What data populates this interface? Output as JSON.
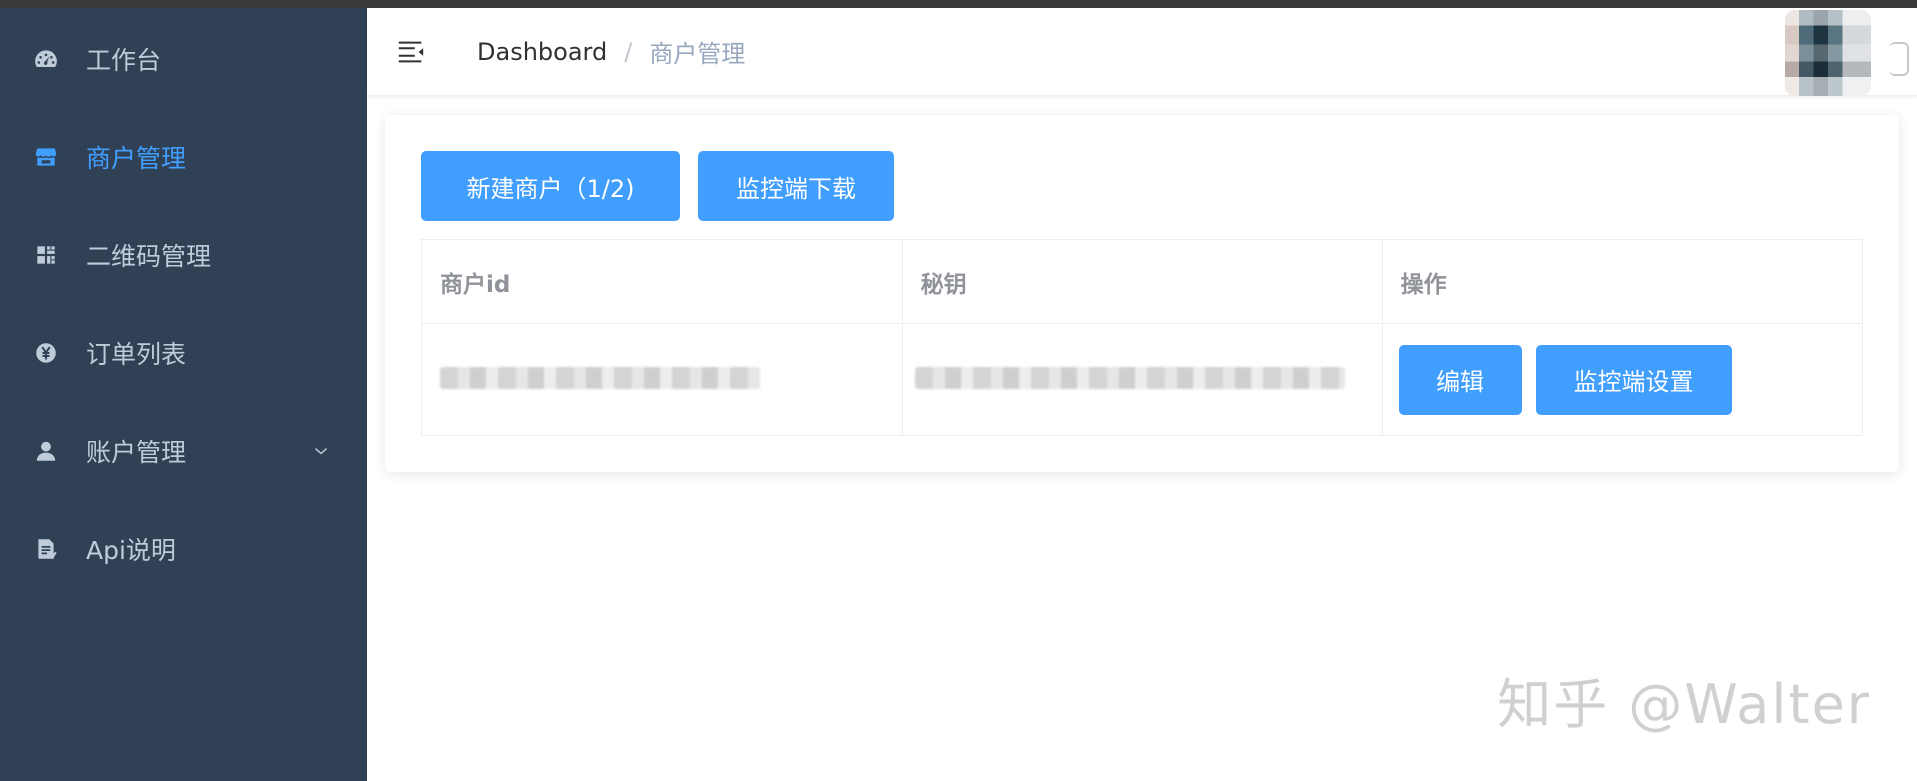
{
  "sidebar": {
    "items": [
      {
        "label": "工作台",
        "icon": "dashboard-icon",
        "active": false
      },
      {
        "label": "商户管理",
        "icon": "store-icon",
        "active": true
      },
      {
        "label": "二维码管理",
        "icon": "qrcode-icon",
        "active": false
      },
      {
        "label": "订单列表",
        "icon": "yen-icon",
        "active": false
      },
      {
        "label": "账户管理",
        "icon": "user-icon",
        "active": false,
        "expandable": true
      },
      {
        "label": "Api说明",
        "icon": "document-icon",
        "active": false
      }
    ]
  },
  "header": {
    "breadcrumb": [
      "Dashboard",
      "商户管理"
    ],
    "separator": "/"
  },
  "toolbar": {
    "new_merchant_label": "新建商户（1/2)",
    "download_label": "监控端下载"
  },
  "table": {
    "columns": [
      "商户id",
      "秘钥",
      "操作"
    ],
    "rows": [
      {
        "merchant_id": "",
        "secret": "",
        "actions": [
          "编辑",
          "监控端设置"
        ]
      }
    ]
  },
  "watermark": "知乎 @Walter",
  "colors": {
    "sidebar_bg": "#304156",
    "sidebar_text": "#bfcbd9",
    "accent": "#409eff",
    "breadcrumb_current": "#97a8be"
  }
}
